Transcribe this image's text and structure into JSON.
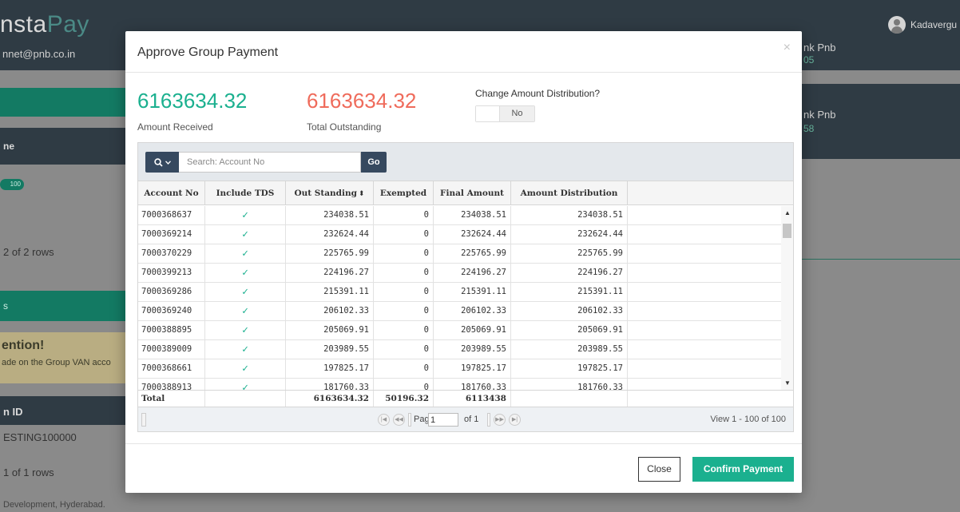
{
  "app": {
    "brand_main": "nsta",
    "brand_accent": "Pay",
    "user_email": "nnet@pnb.co.in",
    "user_name": "Kadavergu",
    "bank_top": "nk Pnb",
    "bank_top_code": "05",
    "colors": {
      "primary": "#1bb08f",
      "danger": "#ef6b5b",
      "dark": "#2f3b44",
      "green_dark": "#137a63"
    }
  },
  "background": {
    "col_header": "ne",
    "pill": "100",
    "rows_info_1": "2 of 2 rows",
    "section_label": "s",
    "attention_title": "ention!",
    "attention_text": "ade on the Group VAN acco",
    "id_header": "n ID",
    "id_value": "ESTING100000",
    "rows_info_2": "1 of 1 rows",
    "footer_text": "Development, Hyderabad.",
    "right_bank": "nk Pnb",
    "right_code": "58"
  },
  "modal": {
    "title": "Approve Group Payment",
    "close_x": "×",
    "amount_received": "6163634.32",
    "amount_received_label": "Amount Received",
    "total_outstanding": "6163634.32",
    "total_outstanding_label": "Total Outstanding",
    "change_dist_label": "Change Amount Distribution?",
    "change_dist_value": "No",
    "search": {
      "placeholder": "Search: Account No",
      "go_label": "Go",
      "icon": "search-icon"
    },
    "columns": [
      "Account No",
      "Include TDS",
      "Out Standing",
      "Exempted",
      "Final Amount",
      "Amount Distribution"
    ],
    "rows": [
      {
        "account": "7000368637",
        "tds": "✓",
        "outstanding": "234038.51",
        "exempted": "0",
        "final": "234038.51",
        "dist": "234038.51"
      },
      {
        "account": "7000369214",
        "tds": "✓",
        "outstanding": "232624.44",
        "exempted": "0",
        "final": "232624.44",
        "dist": "232624.44"
      },
      {
        "account": "7000370229",
        "tds": "✓",
        "outstanding": "225765.99",
        "exempted": "0",
        "final": "225765.99",
        "dist": "225765.99"
      },
      {
        "account": "7000399213",
        "tds": "✓",
        "outstanding": "224196.27",
        "exempted": "0",
        "final": "224196.27",
        "dist": "224196.27"
      },
      {
        "account": "7000369286",
        "tds": "✓",
        "outstanding": "215391.11",
        "exempted": "0",
        "final": "215391.11",
        "dist": "215391.11"
      },
      {
        "account": "7000369240",
        "tds": "✓",
        "outstanding": "206102.33",
        "exempted": "0",
        "final": "206102.33",
        "dist": "206102.33"
      },
      {
        "account": "7000388895",
        "tds": "✓",
        "outstanding": "205069.91",
        "exempted": "0",
        "final": "205069.91",
        "dist": "205069.91"
      },
      {
        "account": "7000389009",
        "tds": "✓",
        "outstanding": "203989.55",
        "exempted": "0",
        "final": "203989.55",
        "dist": "203989.55"
      },
      {
        "account": "7000368661",
        "tds": "✓",
        "outstanding": "197825.17",
        "exempted": "0",
        "final": "197825.17",
        "dist": "197825.17"
      },
      {
        "account": "7000388913",
        "tds": "✓",
        "outstanding": "181760.33",
        "exempted": "0",
        "final": "181760.33",
        "dist": "181760.33"
      }
    ],
    "totals": {
      "label": "Total",
      "outstanding": "6163634.32",
      "exempted": "50196.32",
      "final": "6113438"
    },
    "pager": {
      "page_label": "Page",
      "page_value": "1",
      "of_label": "of 1",
      "view_text": "View 1 - 100 of 100"
    },
    "close_label": "Close",
    "confirm_label": "Confirm Payment"
  }
}
